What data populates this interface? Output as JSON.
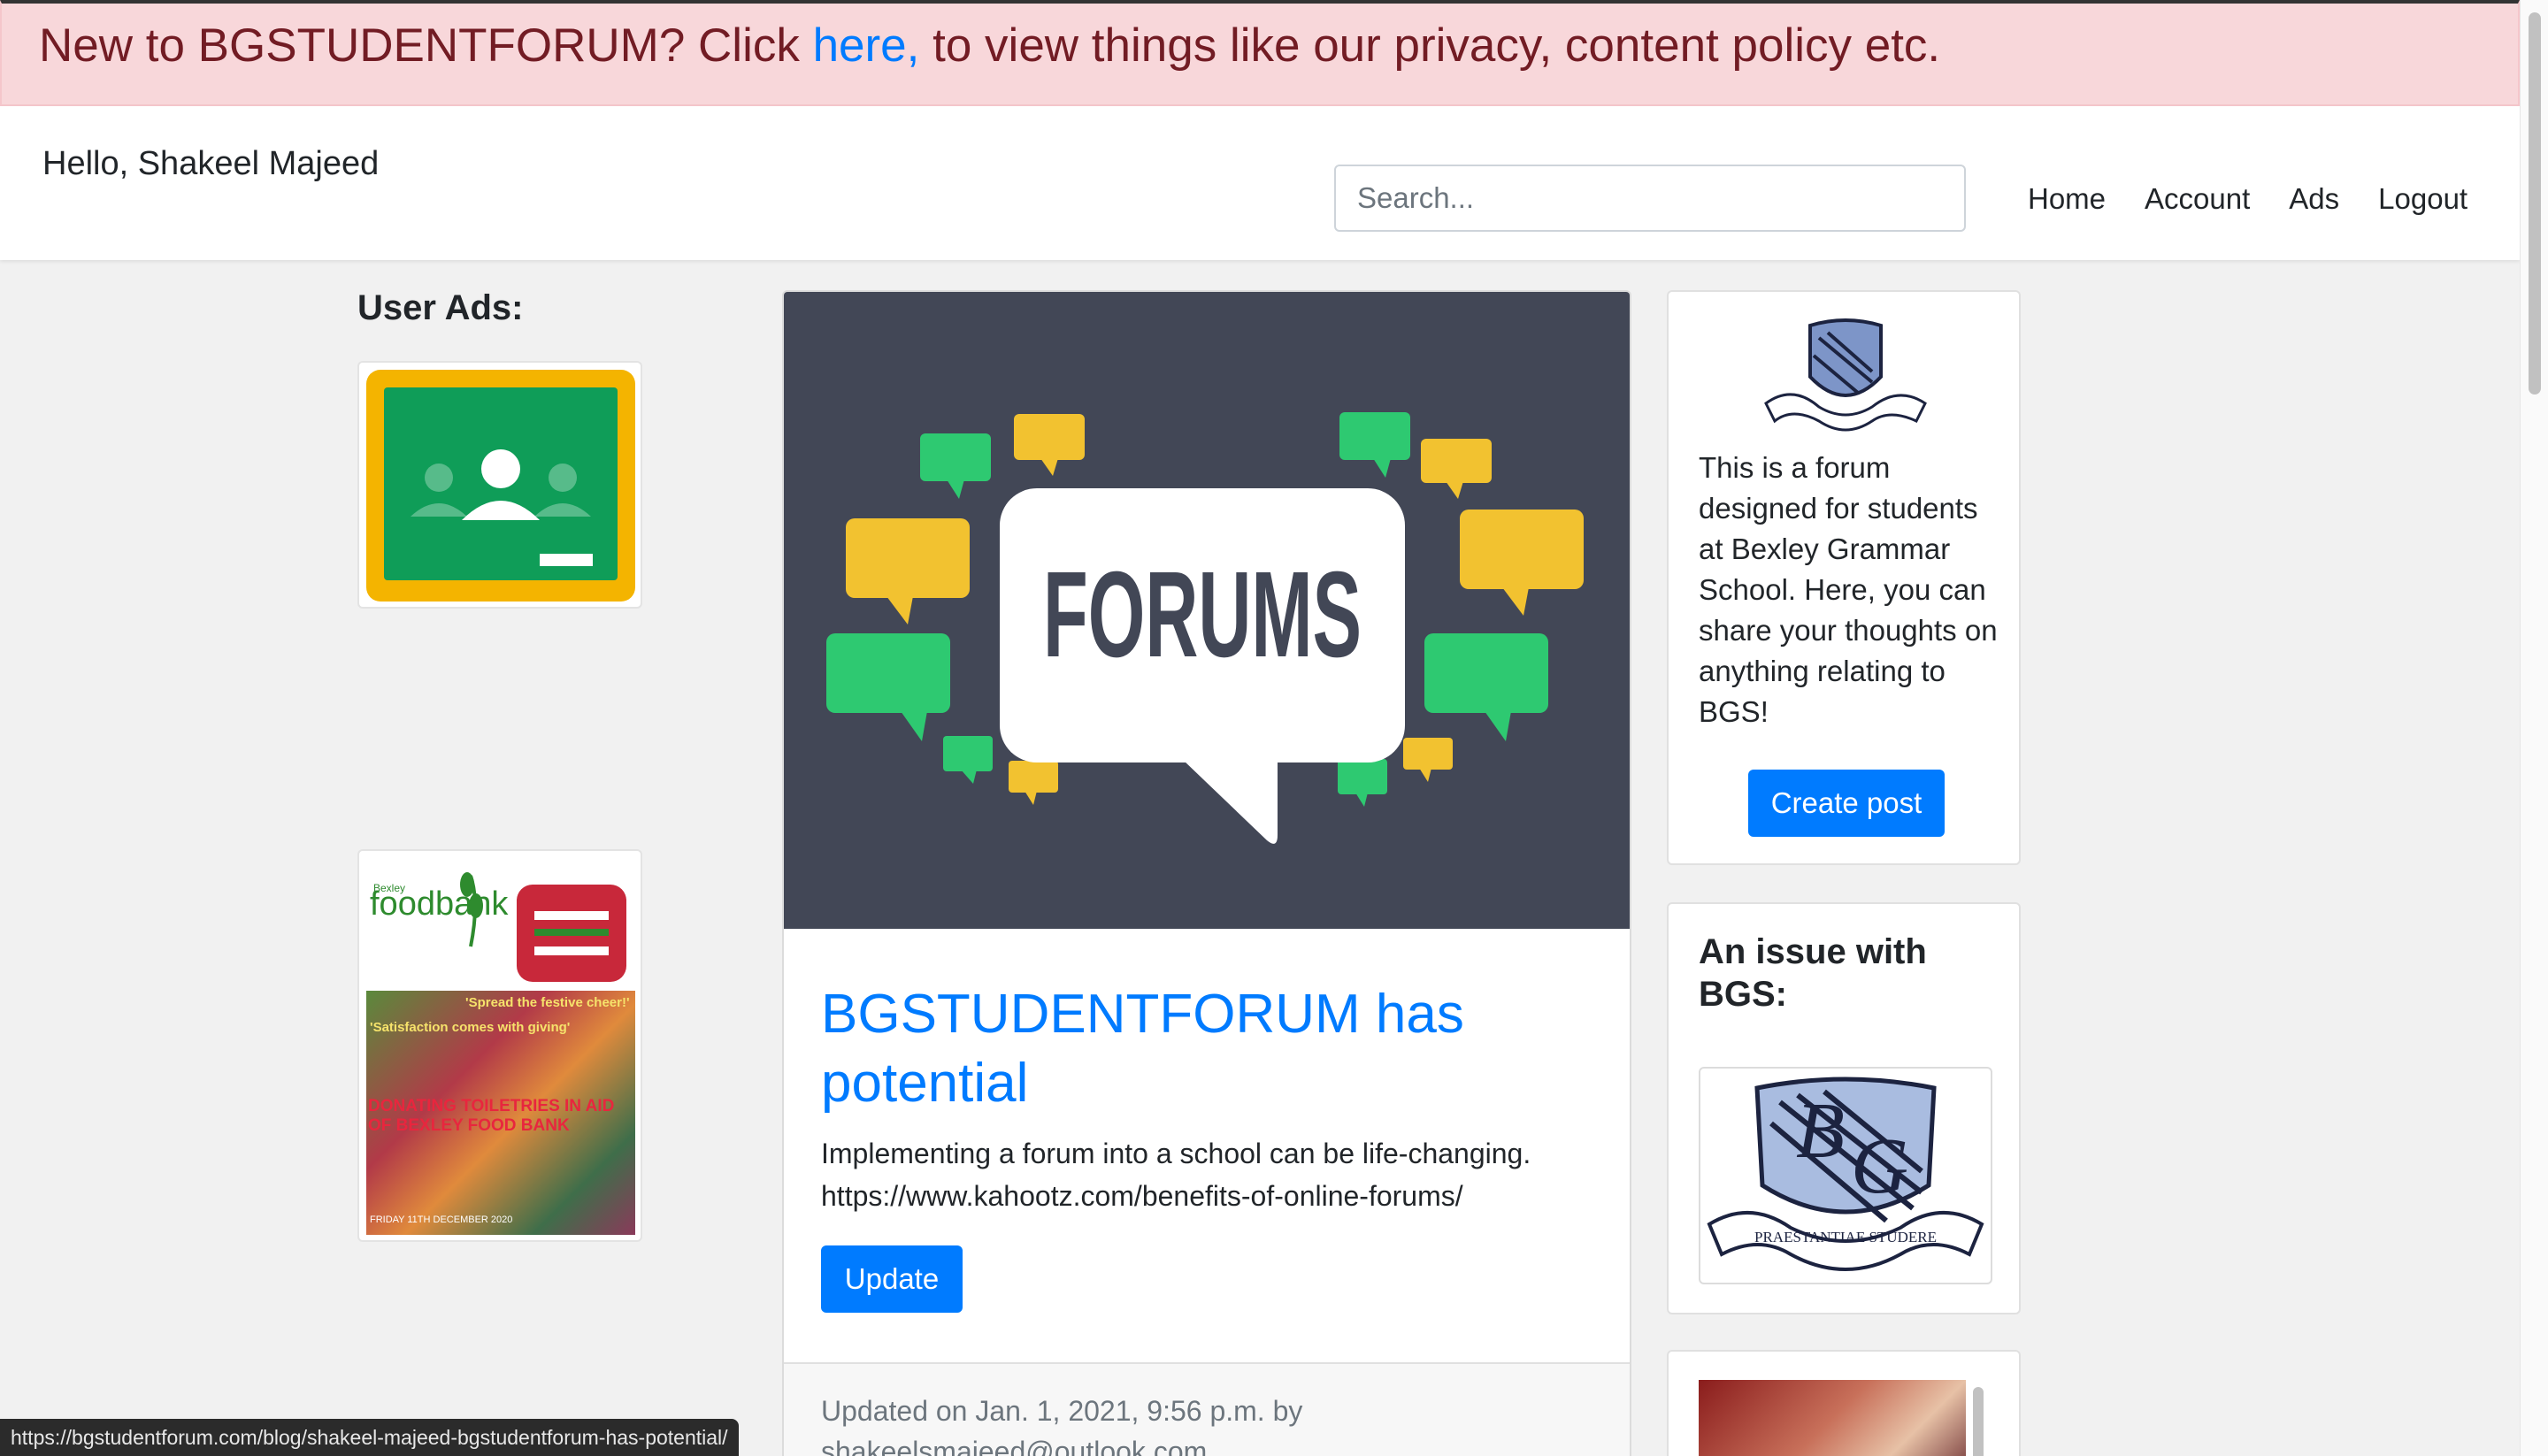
{
  "banner": {
    "prefix": "New to BGSTUDENTFORUM? Click ",
    "link": "here,",
    "suffix": " to view things like our privacy, content policy etc."
  },
  "navbar": {
    "greeting": "Hello, Shakeel Majeed",
    "search_placeholder": "Search...",
    "links": [
      "Home",
      "Account",
      "Ads",
      "Logout"
    ]
  },
  "ads": {
    "title": "User Ads:"
  },
  "post": {
    "image_text": "FORUMS",
    "title": "BGSTUDENTFORUM has potential",
    "body_line1": "Implementing a forum into a school can be life-changing.",
    "body_line2": "https://www.kahootz.com/benefits-of-online-forums/",
    "update_label": "Update",
    "meta_line1": "Updated on Jan. 1, 2021, 9:56 p.m. by",
    "meta_line2": "shakeelsmajeed@outlook.com"
  },
  "sidebar": {
    "description": "This is a forum designed for students at Bexley Grammar School. Here, you can share your thoughts on anything relating to BGS!",
    "create_label": "Create post",
    "issue_title": "An issue with BGS:",
    "crest_motto": "PRAESTANTIAE STUDERE"
  },
  "foodbank_poster": {
    "brand_small": "Bexley",
    "brand": "foodbank",
    "slogan1": "'Spread the festive cheer!'",
    "slogan2": "'Satisfaction comes with giving'",
    "headline": "DONATING TOILETRIES IN AID OF BEXLEY FOOD BANK",
    "footer": "FRIDAY 11TH DECEMBER 2020"
  },
  "statusbar": {
    "url": "https://bgstudentforum.com/blog/shakeel-majeed-bgstudentforum-has-potential/"
  },
  "colors": {
    "banner_bg": "#f8d7da",
    "banner_text": "#721c24",
    "primary": "#007bff",
    "forum_bg": "#424756",
    "bubble_green": "#2ec971",
    "bubble_yellow": "#f2c230"
  }
}
